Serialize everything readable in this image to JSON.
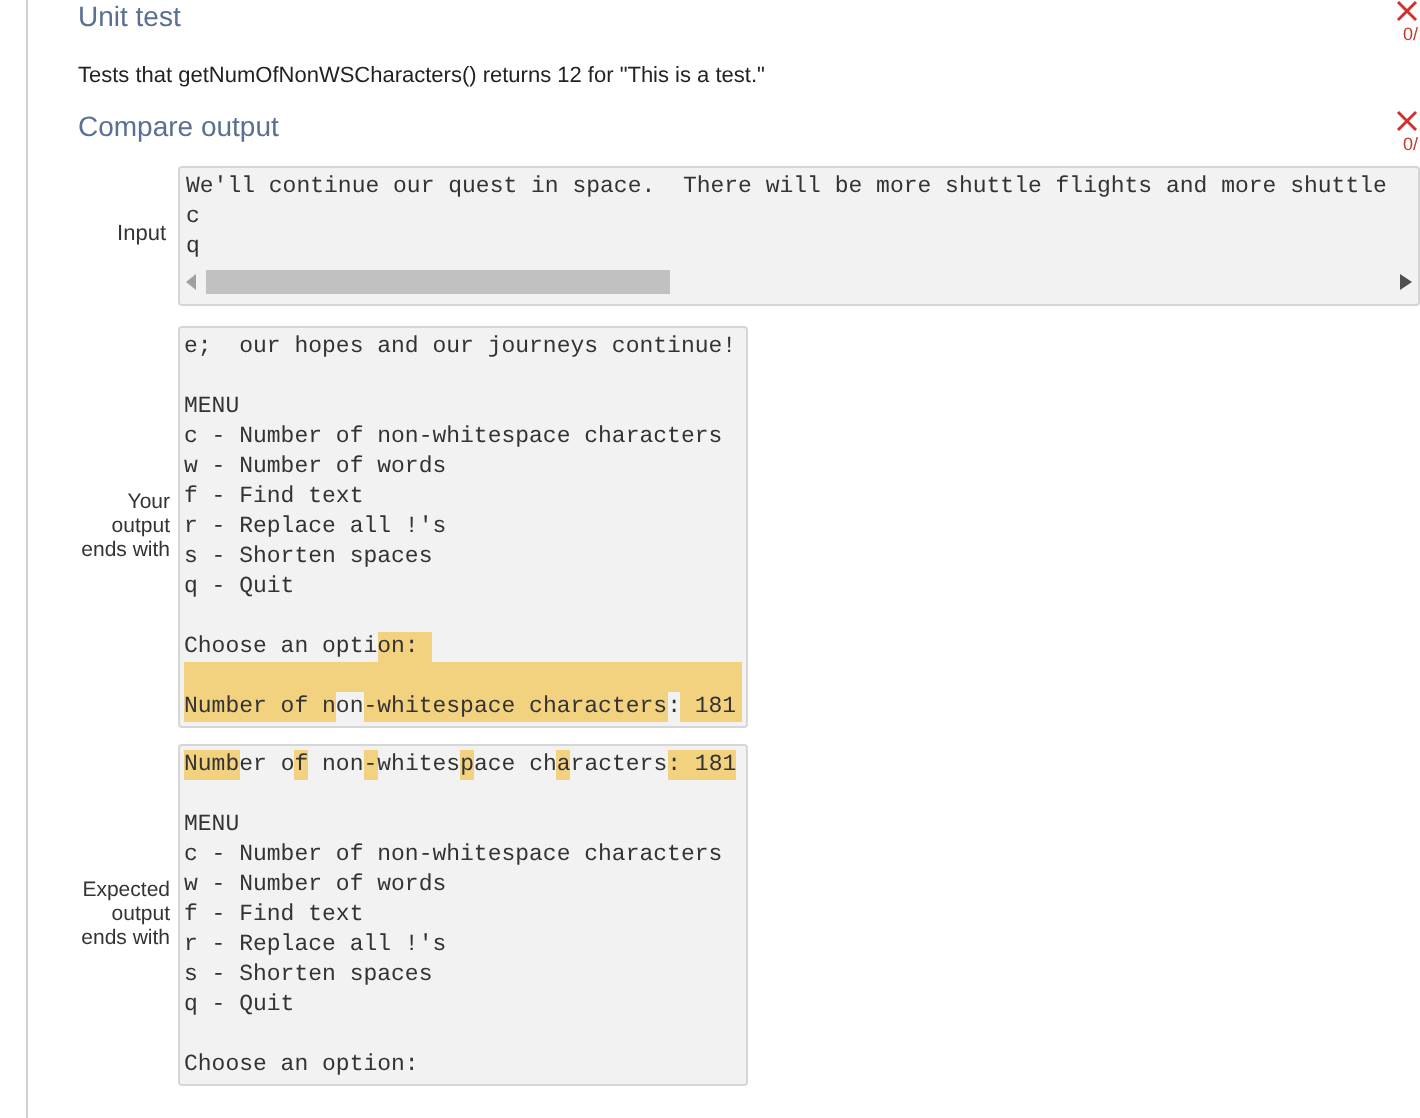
{
  "sections": [
    {
      "title": "Unit test",
      "score": "0/",
      "failed": true,
      "description": "Tests that getNumOfNonWSCharacters() returns 12 for \"This is a test.\""
    },
    {
      "title": "Compare output",
      "score": "0/",
      "failed": true
    }
  ],
  "input": {
    "label": "Input",
    "lines": [
      "We'll continue our quest in space.  There will be more shuttle flights and more shuttle",
      "c",
      "q"
    ]
  },
  "outputs": [
    {
      "label": "Your output ends with",
      "lines": [
        {
          "kind": "text",
          "segments": [
            {
              "text": "e;  our hopes and our journeys continue!",
              "highlight": false
            }
          ]
        },
        {
          "kind": "blank"
        },
        {
          "kind": "text",
          "segments": [
            {
              "text": "MENU",
              "highlight": false
            }
          ]
        },
        {
          "kind": "text",
          "segments": [
            {
              "text": "c - Number of non-whitespace characters",
              "highlight": false
            }
          ]
        },
        {
          "kind": "text",
          "segments": [
            {
              "text": "w - Number of words",
              "highlight": false
            }
          ]
        },
        {
          "kind": "text",
          "segments": [
            {
              "text": "f - Find text",
              "highlight": false
            }
          ]
        },
        {
          "kind": "text",
          "segments": [
            {
              "text": "r - Replace all !'s",
              "highlight": false
            }
          ]
        },
        {
          "kind": "text",
          "segments": [
            {
              "text": "s - Shorten spaces",
              "highlight": false
            }
          ]
        },
        {
          "kind": "text",
          "segments": [
            {
              "text": "q - Quit",
              "highlight": false
            }
          ]
        },
        {
          "kind": "blank"
        },
        {
          "kind": "text",
          "segments": [
            {
              "text": "Choose an opti",
              "highlight": false
            },
            {
              "text": "on: ",
              "highlight": true
            }
          ]
        },
        {
          "kind": "blank",
          "highlighted": true
        },
        {
          "kind": "text",
          "highlighted": true,
          "segments": [
            {
              "text": "Number of n",
              "highlight": true
            },
            {
              "text": "on",
              "highlight": false
            },
            {
              "text": "-whitespace characters",
              "highlight": true
            },
            {
              "text": ":",
              "highlight": false
            },
            {
              "text": " 181",
              "highlight": true
            }
          ]
        }
      ]
    },
    {
      "label": "Expected output ends with",
      "lines": [
        {
          "kind": "text",
          "segments": [
            {
              "text": "Numb",
              "highlight": true
            },
            {
              "text": "er o",
              "highlight": false
            },
            {
              "text": "f",
              "highlight": true
            },
            {
              "text": " non",
              "highlight": false
            },
            {
              "text": "-",
              "highlight": true
            },
            {
              "text": "whites",
              "highlight": false
            },
            {
              "text": "p",
              "highlight": true
            },
            {
              "text": "ace ch",
              "highlight": false
            },
            {
              "text": "a",
              "highlight": true
            },
            {
              "text": "racters",
              "highlight": false
            },
            {
              "text": ": 181",
              "highlight": true
            }
          ]
        },
        {
          "kind": "blank"
        },
        {
          "kind": "text",
          "segments": [
            {
              "text": "MENU",
              "highlight": false
            }
          ]
        },
        {
          "kind": "text",
          "segments": [
            {
              "text": "c - Number of non-whitespace characters",
              "highlight": false
            }
          ]
        },
        {
          "kind": "text",
          "segments": [
            {
              "text": "w - Number of words",
              "highlight": false
            }
          ]
        },
        {
          "kind": "text",
          "segments": [
            {
              "text": "f - Find text",
              "highlight": false
            }
          ]
        },
        {
          "kind": "text",
          "segments": [
            {
              "text": "r - Replace all !'s",
              "highlight": false
            }
          ]
        },
        {
          "kind": "text",
          "segments": [
            {
              "text": "s - Shorten spaces",
              "highlight": false
            }
          ]
        },
        {
          "kind": "text",
          "segments": [
            {
              "text": "q - Quit",
              "highlight": false
            }
          ]
        },
        {
          "kind": "blank"
        },
        {
          "kind": "text",
          "segments": [
            {
              "text": "Choose an option:",
              "highlight": false
            }
          ]
        }
      ]
    }
  ]
}
